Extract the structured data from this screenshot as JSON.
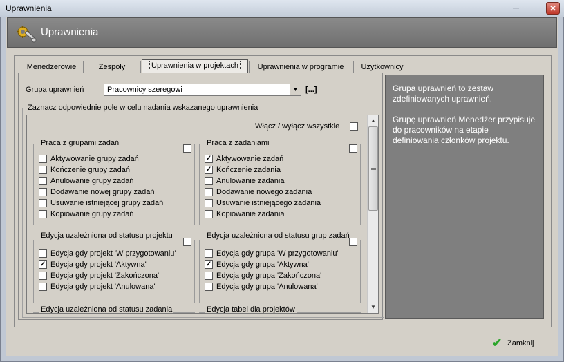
{
  "window": {
    "title": "Uprawnienia"
  },
  "header": {
    "title": "Uprawnienia",
    "icon": "wrench-gear-icon"
  },
  "tabs": [
    {
      "label": "Menedżerowie",
      "active": false
    },
    {
      "label": "Zespoły",
      "active": false
    },
    {
      "label": "Uprawnienia w projektach",
      "active": true
    },
    {
      "label": "Uprawnienia w programie",
      "active": false
    },
    {
      "label": "Użytkownicy",
      "active": false
    }
  ],
  "group": {
    "label": "Grupa uprawnień",
    "selected": "Pracownicy szeregowi",
    "more_label": "[...]"
  },
  "permissions": {
    "title": "Zaznacz odpowiednie pole w celu nadania wskazanego uprawnienia",
    "toggle_all_label": "Włącz / wyłącz wszystkie",
    "sections": [
      {
        "title": "Praca z grupami zadań",
        "items": [
          {
            "label": "Aktywowanie grupy zadań",
            "checked": false
          },
          {
            "label": "Kończenie grupy zadań",
            "checked": false
          },
          {
            "label": "Anulowanie grupy zadań",
            "checked": false
          },
          {
            "label": "Dodawanie nowej grupy zadań",
            "checked": false
          },
          {
            "label": "Usuwanie istniejącej grupy zadań",
            "checked": false
          },
          {
            "label": "Kopiowanie grupy zadań",
            "checked": false
          }
        ]
      },
      {
        "title": "Praca z zadaniami",
        "items": [
          {
            "label": "Aktywowanie zadań",
            "checked": true
          },
          {
            "label": "Kończenie zadania",
            "checked": true
          },
          {
            "label": "Anulowanie zadania",
            "checked": false
          },
          {
            "label": "Dodawanie nowego zadania",
            "checked": false
          },
          {
            "label": "Usuwanie istniejącego zadania",
            "checked": false
          },
          {
            "label": "Kopiowanie zadania",
            "checked": false
          }
        ]
      },
      {
        "title": "Edycja uzależniona od statusu projektu",
        "items": [
          {
            "label": "Edycja gdy projekt 'W przygotowaniu'",
            "checked": false
          },
          {
            "label": "Edycja gdy projekt 'Aktywna'",
            "checked": true
          },
          {
            "label": "Edycja gdy projekt 'Zakończona'",
            "checked": false
          },
          {
            "label": "Edycja gdy projekt 'Anulowana'",
            "checked": false
          }
        ]
      },
      {
        "title": "Edycja uzależniona od statusu grup zadań",
        "items": [
          {
            "label": "Edycja gdy grupa 'W przygotowaniu'",
            "checked": false
          },
          {
            "label": "Edycja gdy grupa 'Aktywna'",
            "checked": true
          },
          {
            "label": "Edycja gdy grupa 'Zakończona'",
            "checked": false
          },
          {
            "label": "Edycja gdy grupa 'Anulowana'",
            "checked": false
          }
        ]
      },
      {
        "title": "Edycja uzależniona od statusu zadania",
        "items": []
      },
      {
        "title": "Edycja tabel dla projektów",
        "items": []
      }
    ]
  },
  "info": {
    "paragraphs": [
      "Grupa uprawnień to zestaw zdefiniowanych uprawnień.",
      "Grupę uprawnień Menedżer przypisuje do pracowników na etapie definiowania członków projektu."
    ]
  },
  "footer": {
    "close_label": "Zamknij"
  },
  "colors": {
    "header_bg": "#7a7a7a",
    "info_bg": "#7f7f7f",
    "close_check": "#2aa52a"
  }
}
